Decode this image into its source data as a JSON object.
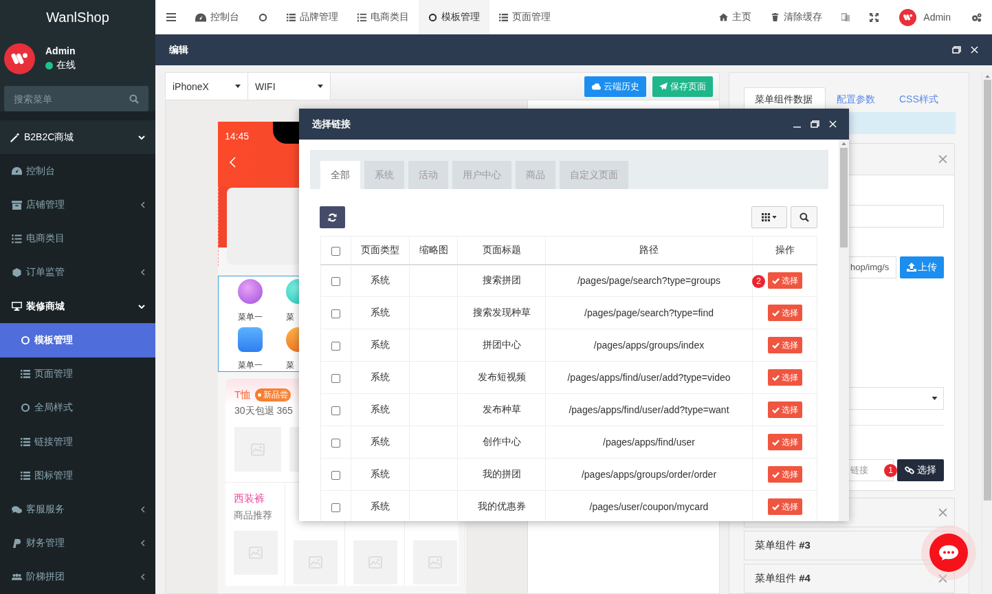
{
  "sidebar": {
    "brand": "WanlShop",
    "user": {
      "name": "Admin",
      "status": "在线",
      "online": true
    },
    "search": {
      "placeholder": "搜索菜单"
    },
    "group": {
      "label": "B2B2C商城",
      "expanded": true
    },
    "menu": [
      {
        "label": "控制台",
        "selected": false
      },
      {
        "label": "店铺管理",
        "selected": false,
        "expanded": false
      },
      {
        "label": "电商类目",
        "selected": false
      },
      {
        "label": "订单监管",
        "selected": false,
        "expanded": false
      },
      {
        "label": "装修商城",
        "selected": false,
        "expanded": true,
        "children": [
          {
            "label": "模板管理",
            "selected": true
          },
          {
            "label": "页面管理",
            "selected": false
          },
          {
            "label": "全局样式",
            "selected": false
          },
          {
            "label": "链接管理",
            "selected": false
          },
          {
            "label": "图标管理",
            "selected": false
          }
        ]
      },
      {
        "label": "客服服务",
        "selected": false,
        "expanded": false
      },
      {
        "label": "财务管理",
        "selected": false,
        "expanded": false
      },
      {
        "label": "阶梯拼团",
        "selected": false,
        "expanded": false
      }
    ]
  },
  "topbar": {
    "tabs": [
      {
        "label": "控制台",
        "selected": false
      },
      {
        "selected": false
      },
      {
        "label": "品牌管理",
        "selected": false
      },
      {
        "label": "电商类目",
        "selected": false
      },
      {
        "label": "模板管理",
        "selected": true
      },
      {
        "label": "页面管理",
        "selected": false
      }
    ],
    "links": [
      "主页",
      "清除缓存"
    ],
    "user": "Admin"
  },
  "window": {
    "title": "编辑"
  },
  "editor": {
    "device": "iPhoneX",
    "network": "WIFI",
    "buttons": [
      "云端历史",
      "保存页面"
    ],
    "phone": {
      "time": "14:45",
      "menu": [
        {
          "label": "菜单一"
        },
        {
          "label": "菜"
        },
        {
          "label": "菜单一"
        },
        {
          "label": "菜"
        }
      ],
      "promo": {
        "title": "T恤",
        "tag": "新品尝",
        "subtitle": "30天包退 365"
      },
      "recommend": {
        "title": "西装裤",
        "subtitle": "商品推荐"
      }
    }
  },
  "settings": {
    "tabs": [
      {
        "label": "菜单组件数据",
        "selected": true
      },
      {
        "label": "配置参数",
        "selected": false
      },
      {
        "label": "CSS样式",
        "selected": false
      }
    ],
    "image_path": "hop/img/s",
    "upload": "上传",
    "link_placeholder": "链接",
    "link_badge": "1",
    "link_button": "选择",
    "cards": [
      "菜单组件 **#3**",
      "菜单组件 **#4**"
    ]
  },
  "link_dialog": {
    "title": "选择链接",
    "tabs": [
      {
        "label": "全部",
        "selected": true
      },
      {
        "label": "系统",
        "selected": false
      },
      {
        "label": "活动",
        "selected": false
      },
      {
        "label": "用户中心",
        "selected": false
      },
      {
        "label": "商品",
        "selected": false
      },
      {
        "label": "自定义页面",
        "selected": false
      }
    ],
    "columns": [
      "页面类型",
      "缩略图",
      "页面标题",
      "路径",
      "操作"
    ],
    "select_all": false,
    "rows": [
      {
        "checked": false,
        "type": "系统",
        "title": "搜索拼团",
        "path": "/pages/page/search?type=groups",
        "action": "选择",
        "badge": "2"
      },
      {
        "checked": false,
        "type": "系统",
        "title": "搜索发现种草",
        "path": "/pages/page/search?type=find",
        "action": "选择"
      },
      {
        "checked": false,
        "type": "系统",
        "title": "拼团中心",
        "path": "/pages/apps/groups/index",
        "action": "选择"
      },
      {
        "checked": false,
        "type": "系统",
        "title": "发布短视频",
        "path": "/pages/apps/find/user/add?type=video",
        "action": "选择"
      },
      {
        "checked": false,
        "type": "系统",
        "title": "发布种草",
        "path": "/pages/apps/find/user/add?type=want",
        "action": "选择"
      },
      {
        "checked": false,
        "type": "系统",
        "title": "创作中心",
        "path": "/pages/apps/find/user",
        "action": "选择"
      },
      {
        "checked": false,
        "type": "系统",
        "title": "我的拼团",
        "path": "/pages/apps/groups/order/order",
        "action": "选择"
      },
      {
        "checked": false,
        "type": "系统",
        "title": "我的优惠券",
        "path": "/pages/user/coupon/mycard",
        "action": "选择"
      }
    ]
  }
}
